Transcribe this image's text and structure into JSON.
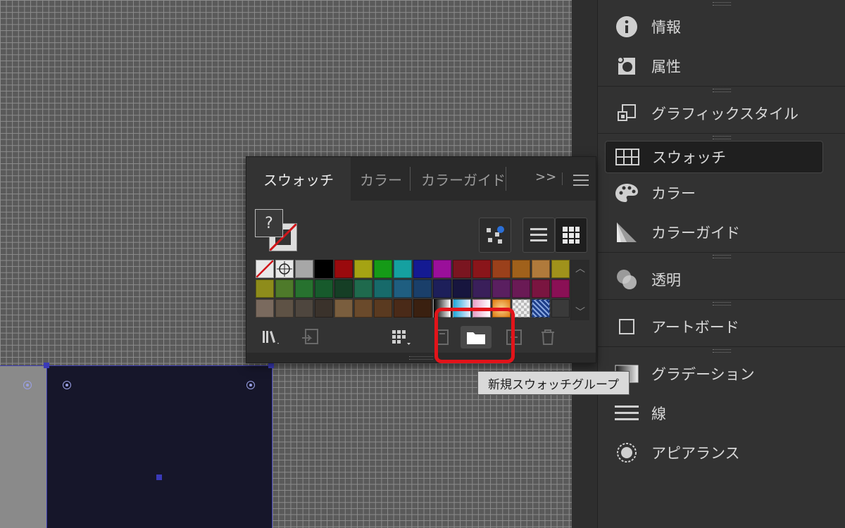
{
  "dock": {
    "groups": [
      {
        "items": [
          {
            "label": "情報",
            "icon": "info-icon"
          },
          {
            "label": "属性",
            "icon": "attributes-icon"
          }
        ]
      },
      {
        "items": [
          {
            "label": "グラフィックスタイル",
            "icon": "graphic-styles-icon"
          }
        ]
      },
      {
        "items": [
          {
            "label": "スウォッチ",
            "icon": "swatches-icon",
            "active": true
          },
          {
            "label": "カラー",
            "icon": "color-palette-icon"
          },
          {
            "label": "カラーガイド",
            "icon": "color-guide-icon"
          }
        ]
      },
      {
        "items": [
          {
            "label": "透明",
            "icon": "transparency-icon"
          }
        ]
      },
      {
        "items": [
          {
            "label": "アートボード",
            "icon": "artboard-icon"
          }
        ]
      },
      {
        "items": [
          {
            "label": "グラデーション",
            "icon": "gradient-icon"
          },
          {
            "label": "線",
            "icon": "stroke-icon"
          },
          {
            "label": "アピアランス",
            "icon": "appearance-icon"
          }
        ]
      }
    ]
  },
  "swatch_panel": {
    "tabs": [
      "スウォッチ",
      "カラー",
      "カラーガイド"
    ],
    "active_tab": "スウォッチ",
    "more_label": ">>",
    "fill_stroke_symbol": "?",
    "swatches_row1": [
      "none",
      "registration",
      "#a7a7a7",
      "#000000",
      "#9a0a0d",
      "#a5a313",
      "#159a17",
      "#15a0a0",
      "#141a92",
      "#9a0f9a",
      "#7a1520",
      "#8a151a",
      "#9a401b",
      "#a0611b",
      "#b07a3b",
      "#a0921b"
    ],
    "swatches_row2": [
      "#8e8c1b",
      "#4e7a2a",
      "#27722f",
      "#175a2c",
      "#153e25",
      "#1f6a4d",
      "#176a6a",
      "#1f5e80",
      "#1a3f6a",
      "#1d1f5a",
      "#17153e",
      "#3a1f5a",
      "#5a1f60",
      "#6a1a55",
      "#7a1540",
      "#8a1055"
    ],
    "swatches_row3": [
      "#7a6a5e",
      "#5e5245",
      "#4e463e",
      "#3a322b",
      "#7a5e3e",
      "#6a4a2b",
      "#5a3a20",
      "#4a2a18",
      "#3a2010",
      "gradient-bw",
      "gradient-blue",
      "gradient-pink",
      "gradient-orange",
      "pattern-checker",
      "pattern-blue",
      "#3a3a3a"
    ],
    "tooltip": "新規スウォッチグループ",
    "highlight_color": "#e2141a"
  }
}
